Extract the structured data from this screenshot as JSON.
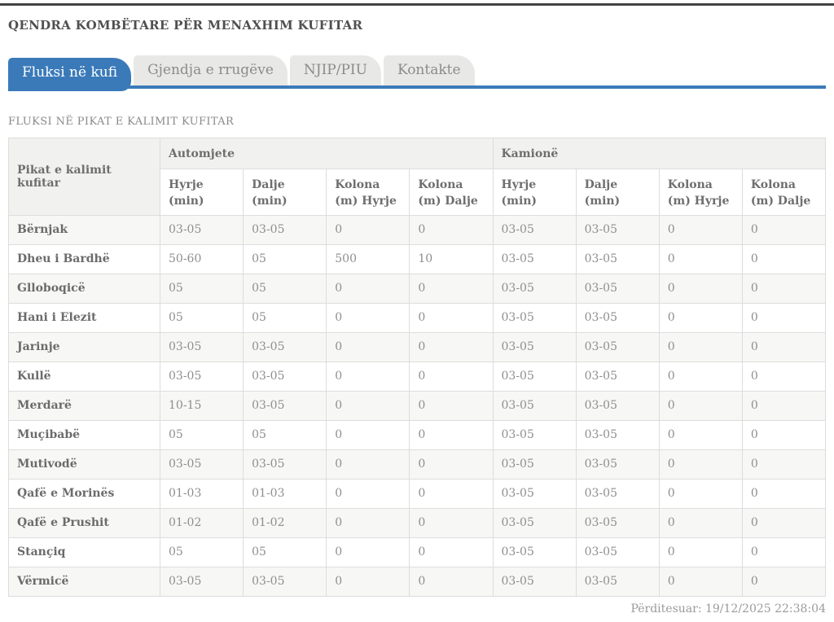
{
  "colors": {
    "accent": "#3b7ab9"
  },
  "header": {
    "title": "QENDRA KOMBËTARE PËR MENAXHIM KUFITAR"
  },
  "tabs": [
    {
      "label": "Fluksi në kufi",
      "active": true
    },
    {
      "label": "Gjendja e rrugëve",
      "active": false
    },
    {
      "label": "NJIP/PIU",
      "active": false
    },
    {
      "label": "Kontakte",
      "active": false
    }
  ],
  "section": {
    "title": "FLUKSI NË PIKAT E KALIMIT KUFITAR"
  },
  "table": {
    "col1_header": "Pikat e kalimit kufitar",
    "groups": [
      {
        "label": "Automjete",
        "columns": [
          "Hyrje (min)",
          "Dalje (min)",
          "Kolona (m) Hyrje",
          "Kolona (m) Dalje"
        ]
      },
      {
        "label": "Kamionë",
        "columns": [
          "Hyrje (min)",
          "Dalje (min)",
          "Kolona (m) Hyrje",
          "Kolona (m) Dalje"
        ]
      }
    ],
    "rows": [
      {
        "name": "Bërnjak",
        "values": [
          "03-05",
          "03-05",
          "0",
          "0",
          "03-05",
          "03-05",
          "0",
          "0"
        ]
      },
      {
        "name": "Dheu i Bardhë",
        "values": [
          "50-60",
          "05",
          "500",
          "10",
          "03-05",
          "03-05",
          "0",
          "0"
        ]
      },
      {
        "name": "Glloboqicë",
        "values": [
          "05",
          "05",
          "0",
          "0",
          "03-05",
          "03-05",
          "0",
          "0"
        ]
      },
      {
        "name": "Hani i Elezit",
        "values": [
          "05",
          "05",
          "0",
          "0",
          "03-05",
          "03-05",
          "0",
          "0"
        ]
      },
      {
        "name": "Jarinje",
        "values": [
          "03-05",
          "03-05",
          "0",
          "0",
          "03-05",
          "03-05",
          "0",
          "0"
        ]
      },
      {
        "name": "Kullë",
        "values": [
          "03-05",
          "03-05",
          "0",
          "0",
          "03-05",
          "03-05",
          "0",
          "0"
        ]
      },
      {
        "name": "Merdarë",
        "values": [
          "10-15",
          "03-05",
          "0",
          "0",
          "03-05",
          "03-05",
          "0",
          "0"
        ]
      },
      {
        "name": "Muçibabë",
        "values": [
          "05",
          "05",
          "0",
          "0",
          "03-05",
          "03-05",
          "0",
          "0"
        ]
      },
      {
        "name": "Mutivodë",
        "values": [
          "03-05",
          "03-05",
          "0",
          "0",
          "03-05",
          "03-05",
          "0",
          "0"
        ]
      },
      {
        "name": "Qafë e Morinës",
        "values": [
          "01-03",
          "01-03",
          "0",
          "0",
          "03-05",
          "03-05",
          "0",
          "0"
        ]
      },
      {
        "name": "Qafë e Prushit",
        "values": [
          "01-02",
          "01-02",
          "0",
          "0",
          "03-05",
          "03-05",
          "0",
          "0"
        ]
      },
      {
        "name": "Stançiq",
        "values": [
          "05",
          "05",
          "0",
          "0",
          "03-05",
          "03-05",
          "0",
          "0"
        ]
      },
      {
        "name": "Vërmicë",
        "values": [
          "03-05",
          "03-05",
          "0",
          "0",
          "03-05",
          "03-05",
          "0",
          "0"
        ]
      }
    ]
  },
  "footer": {
    "updated": "Përditesuar: 19/12/2025 22:38:04"
  }
}
